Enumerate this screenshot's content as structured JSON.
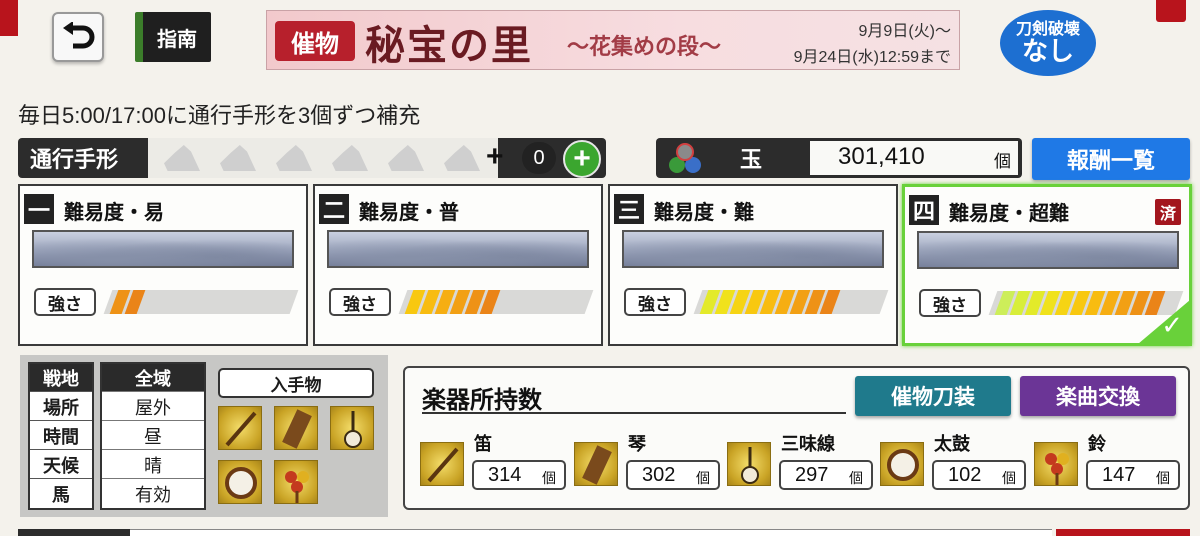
{
  "header": {
    "guide_label": "指南",
    "banner": {
      "tag": "催物",
      "title": "秘宝の里",
      "subtitle": "〜花集めの段〜",
      "date_start": "9月9日(火)〜",
      "date_end": "9月24日(水)12:59まで"
    },
    "break_badge": {
      "line1": "刀剣破壊",
      "line2": "なし"
    }
  },
  "refill_note": "毎日5:00/17:00に通行手形を3個ずつ補充",
  "pass": {
    "label": "通行手形",
    "plus_sign": "+",
    "count": "0",
    "add_label": "+"
  },
  "gem": {
    "label": "玉",
    "value": "301,410",
    "unit": "個"
  },
  "rewards_button": "報酬一覧",
  "difficulties": [
    {
      "num": "一",
      "title": "難易度・易",
      "strength_label": "強さ",
      "strength_level": 2,
      "cleared": false
    },
    {
      "num": "二",
      "title": "難易度・普",
      "strength_label": "強さ",
      "strength_level": 6,
      "cleared": false
    },
    {
      "num": "三",
      "title": "難易度・難",
      "strength_label": "強さ",
      "strength_level": 9,
      "cleared": false
    },
    {
      "num": "四",
      "title": "難易度・超難",
      "strength_label": "強さ",
      "strength_level": 11,
      "cleared": true,
      "cleared_label": "済",
      "selected": true
    }
  ],
  "conditions": {
    "labels": [
      "戦地",
      "場所",
      "時間",
      "天候",
      "馬"
    ],
    "values": [
      "全域",
      "屋外",
      "昼",
      "晴",
      "有効"
    ],
    "obtain_header": "入手物"
  },
  "instruments": {
    "title": "楽器所持数",
    "event_sword_button": "催物刀装",
    "song_exchange_button": "楽曲交換",
    "items": [
      {
        "name": "笛",
        "count": "314",
        "unit": "個"
      },
      {
        "name": "琴",
        "count": "302",
        "unit": "個"
      },
      {
        "name": "三味線",
        "count": "297",
        "unit": "個"
      },
      {
        "name": "太鼓",
        "count": "102",
        "unit": "個"
      },
      {
        "name": "鈴",
        "count": "147",
        "unit": "個"
      }
    ]
  },
  "colors": {
    "accent_red": "#b8141c",
    "rewards_blue": "#1f79e6",
    "selected_green": "#69d13a",
    "teal_button": "#1f7a8c",
    "purple_button": "#6b3596"
  }
}
